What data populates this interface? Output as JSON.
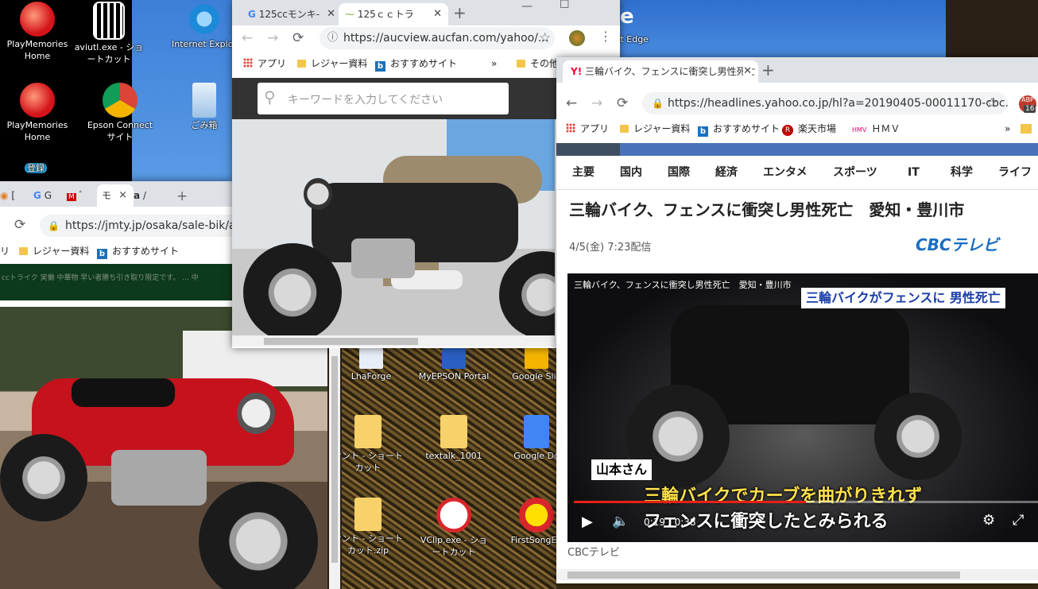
{
  "desktop": {
    "icons": [
      {
        "label": "PlayMemories Home"
      },
      {
        "label": "aviutl.exe - ショートカット"
      },
      {
        "label": "Internet Explor"
      },
      {
        "label": "PlayMemories Home"
      },
      {
        "label": "Epson Connect サイト"
      },
      {
        "label": "ごみ箱"
      },
      {
        "label": "oft Edge"
      },
      {
        "label": "LhaForge"
      },
      {
        "label": "MyEPSON Portal"
      },
      {
        "label": "Google Slic"
      },
      {
        "label": "オント - ショートカット"
      },
      {
        "label": "textalk_1001"
      },
      {
        "label": "Google Do"
      },
      {
        "label": "オント - ショートカット.zip"
      },
      {
        "label": "VClip.exe - ショートカット"
      },
      {
        "label": "FirstSongEd"
      },
      {
        "label": "登録"
      }
    ]
  },
  "win_left": {
    "tabs": [
      "[",
      "G",
      "ﾞ",
      "モ",
      "×",
      "a",
      "/"
    ],
    "url": "https://jmty.jp/osaka/sale-bik/arti",
    "bookmarks": [
      "リ",
      "レジャー資料",
      "おすすめサイト"
    ],
    "banner": "ccトライク 実働 中華物 早い者勝ち引き取り限定です。 ... 中"
  },
  "win_mid": {
    "tabs": [
      {
        "label": "125ccモンキ-"
      },
      {
        "label": "125ｃｃトラ"
      }
    ],
    "url": "https://aucview.aucfan.com/yahoo/...",
    "bookmarks": {
      "apps": "アプリ",
      "leisure": "レジャー資料",
      "recommended": "おすすめサイト",
      "more": "»",
      "other": "その他"
    },
    "search_placeholder": "キーワードを入力してください"
  },
  "win_right": {
    "tab_label": "三輪バイク、フェンスに衝突し男性死亡",
    "url": "https://headlines.yahoo.co.jp/hl?a=20190405-00011170-cbc...",
    "badge": "16",
    "bookmarks": {
      "apps": "アプリ",
      "leisure": "レジャー資料",
      "recommended": "おすすめサイト",
      "rakuten": "楽天市場",
      "hmv": "ＨＭＶ",
      "more": "»"
    },
    "nav": [
      "主要",
      "国内",
      "国際",
      "経済",
      "エンタメ",
      "スポーツ",
      "IT",
      "科学",
      "ライフ"
    ],
    "headline": "三輪バイク、フェンスに衝突し男性死亡　愛知・豊川市",
    "date": "4/5(金) 7:23配信",
    "source_logo": "CBCテレビ",
    "video": {
      "title": "三輪バイク、フェンスに衝突し男性死亡　愛知・豊川市",
      "caption_top": "三輪バイクがフェンスに 男性死亡",
      "name_tag": "山本さん",
      "subtitle1": "三輪バイクでカーブを曲がりきれず",
      "subtitle2": "フェンスに衝突したとみられる",
      "time": "0:19 / 0:38",
      "progress": 0.5
    },
    "credit": "CBCテレビ"
  }
}
